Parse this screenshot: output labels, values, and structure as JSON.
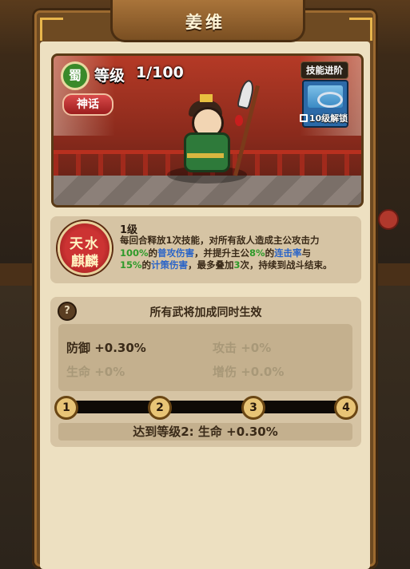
{
  "title": "姜维",
  "hero": {
    "kingdom": "蜀",
    "level_label": "等级",
    "level_value": "1/100",
    "rarity": "神话",
    "level_current": 1,
    "level_max": 100
  },
  "skill_upgrade": {
    "label": "技能进阶",
    "unlock_text": "10级解锁",
    "icon": "sword-skill-icon"
  },
  "skill": {
    "icon_line1": "天水",
    "icon_line2": "麒麟",
    "level": "1级",
    "desc": {
      "p1": "每回合释放1次技能，对所有敌人造成主公攻击力",
      "p2_pct": "100%",
      "p2_of": "的",
      "p2_type": "普攻伤害",
      "p2_mid": "，并提升主公",
      "p2_pct2": "8%",
      "p2_of2": "的",
      "p2_stat": "连击率",
      "p2_and": "与",
      "p3_pct": "15%",
      "p3_of": "的",
      "p3_stat": "计策伤害",
      "p3_mid": "，最多叠加",
      "p3_count": "3",
      "p3_end": "次，持续到战斗结束。"
    }
  },
  "bonus": {
    "help_symbol": "?",
    "title": "所有武将加成同时生效",
    "stats": [
      {
        "label": "防御 +0.30%",
        "active": true
      },
      {
        "label": "攻击 +0%",
        "active": false
      },
      {
        "label": "生命 +0%",
        "active": false
      },
      {
        "label": "增伤 +0.0%",
        "active": false
      }
    ],
    "nodes": [
      "1",
      "2",
      "3",
      "4"
    ],
    "next": "达到等级2: 生命 +0.30%"
  },
  "colors": {
    "accent_green": "#2e9a2a",
    "accent_blue": "#2a64c8",
    "rarity_red": "#c33333",
    "panel_brown": "#6e4a22",
    "parchment": "#ede0c1"
  }
}
